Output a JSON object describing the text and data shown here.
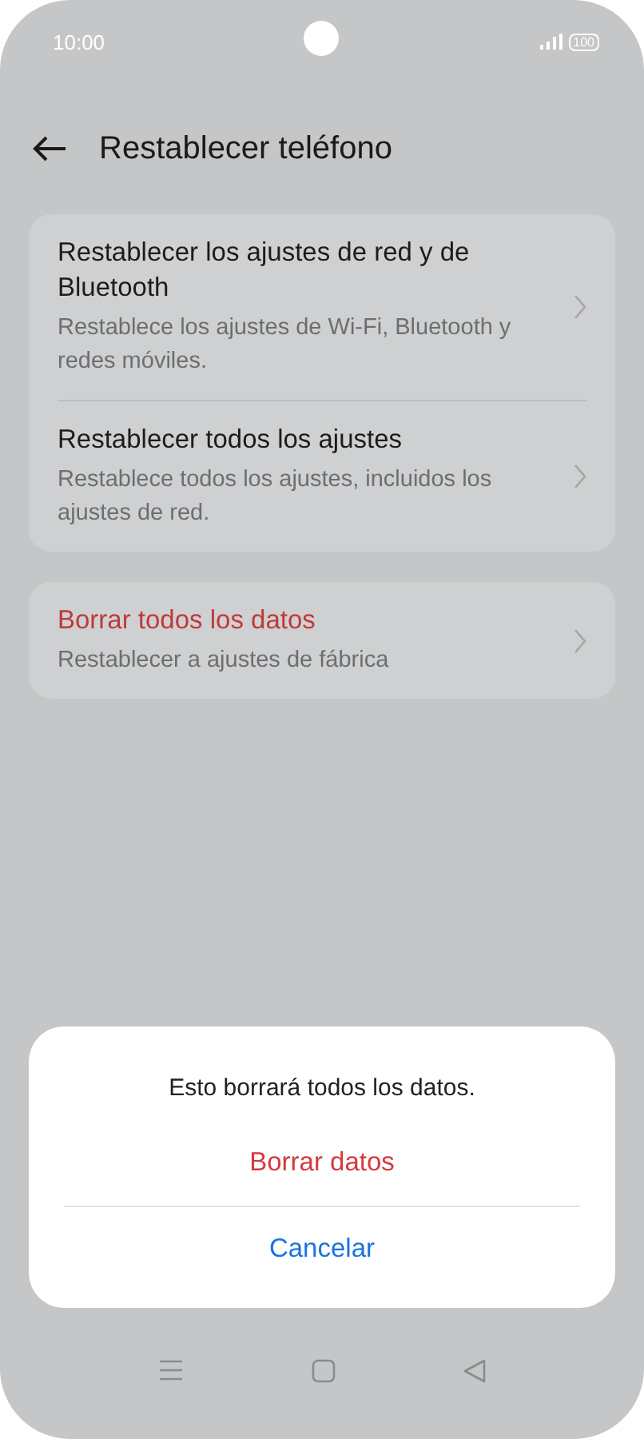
{
  "status_bar": {
    "time": "10:00",
    "battery": "100"
  },
  "header": {
    "title": "Restablecer teléfono"
  },
  "groups": [
    {
      "items": [
        {
          "title": "Restablecer los ajustes de red y de Bluetooth",
          "subtitle": "Restablece los ajustes de Wi-Fi, Bluetooth y redes móviles.",
          "kind": "normal"
        },
        {
          "title": "Restablecer todos los ajustes",
          "subtitle": "Restablece todos los ajustes, incluidos los ajustes de red.",
          "kind": "normal"
        }
      ]
    },
    {
      "items": [
        {
          "title": "Borrar todos los datos",
          "subtitle": "Restablecer a ajustes de fábrica",
          "kind": "danger"
        }
      ]
    }
  ],
  "dialog": {
    "message": "Esto borrará todos los datos.",
    "buttons": [
      {
        "label": "Borrar datos",
        "kind": "destructive"
      },
      {
        "label": "Cancelar",
        "kind": "cancel"
      }
    ]
  }
}
